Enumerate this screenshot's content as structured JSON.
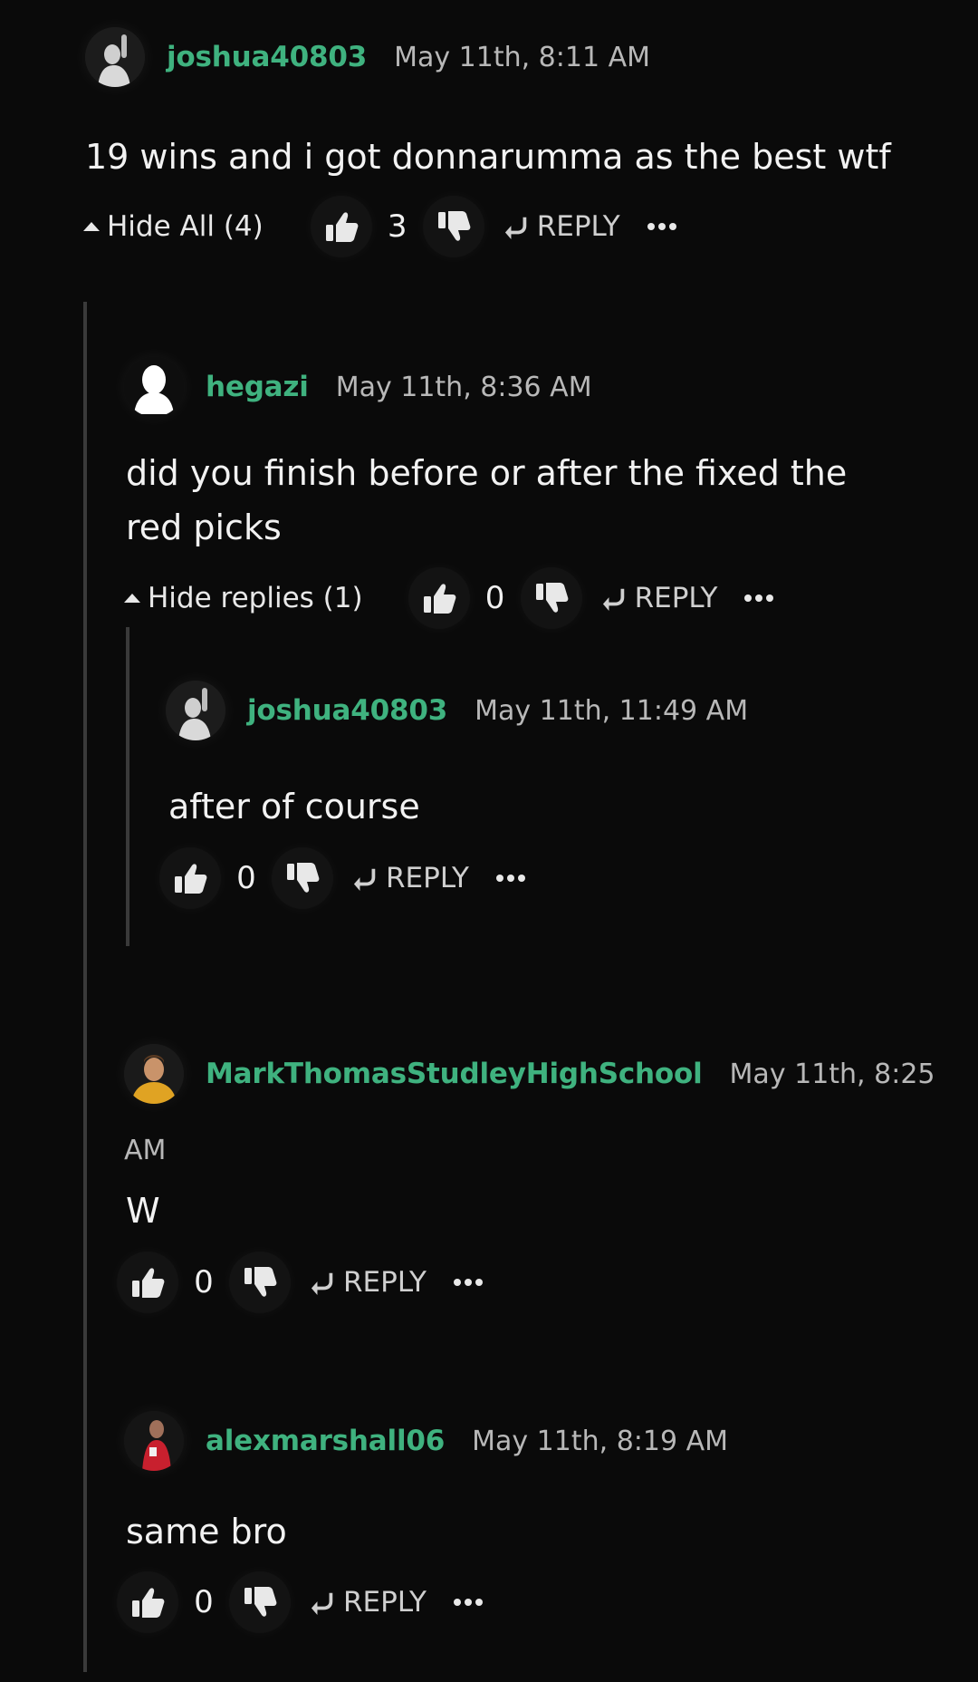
{
  "comments": [
    {
      "username": "joshua40803",
      "date": "May 11th, 8:11 AM",
      "text": "19 wins and i got donnarumma as the best wtf",
      "toggle": "Hide All (4)",
      "likes": "3",
      "reply_label": "REPLY"
    },
    {
      "username": "hegazi",
      "date": "May 11th, 8:36 AM",
      "text": "did you finish before or after the fixed the red picks",
      "toggle": "Hide replies (1)",
      "likes": "0",
      "reply_label": "REPLY"
    },
    {
      "username": "joshua40803",
      "date": "May 11th, 11:49 AM",
      "text": "after of course",
      "likes": "0",
      "reply_label": "REPLY"
    },
    {
      "username": "MarkThomasStudleyHighSchool",
      "date_part1": "May 11th, 8:25",
      "date_part2": "AM",
      "text": "W",
      "likes": "0",
      "reply_label": "REPLY"
    },
    {
      "username": "alexmarshall06",
      "date": "May 11th, 8:19 AM",
      "text": "same bro",
      "likes": "0",
      "reply_label": "REPLY"
    }
  ],
  "icons": {
    "like": "thumbs-up-icon",
    "dislike": "thumbs-down-icon",
    "reply": "reply-arrow-icon",
    "more": "more-dots-icon",
    "collapse": "caret-up-icon"
  },
  "colors": {
    "background": "#0a0a0a",
    "username": "#3fb27f",
    "date": "#b8b8b8",
    "text": "#f2f2f2",
    "thread_line": "#3a3a3a"
  }
}
